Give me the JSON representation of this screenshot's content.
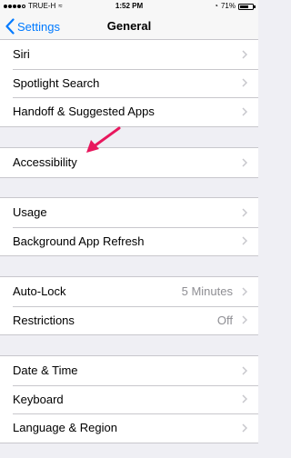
{
  "status_bar": {
    "carrier": "TRUE-H",
    "time": "1:52 PM",
    "battery": "71%",
    "battery_level": 0.71
  },
  "nav": {
    "back_label": "Settings",
    "title": "General"
  },
  "groups": [
    [
      {
        "label": "Siri"
      },
      {
        "label": "Spotlight Search"
      },
      {
        "label": "Handoff & Suggested Apps"
      }
    ],
    [
      {
        "label": "Accessibility"
      }
    ],
    [
      {
        "label": "Usage"
      },
      {
        "label": "Background App Refresh"
      }
    ],
    [
      {
        "label": "Auto-Lock",
        "value": "5 Minutes"
      },
      {
        "label": "Restrictions",
        "value": "Off"
      }
    ],
    [
      {
        "label": "Date & Time"
      },
      {
        "label": "Keyboard"
      },
      {
        "label": "Language & Region"
      }
    ]
  ],
  "colors": {
    "accent": "#007aff",
    "annotation_arrow": "#e8175d",
    "background": "#efeff4"
  },
  "icons": {
    "back": "chevron-left-icon",
    "disclosure": "chevron-right-icon",
    "annotation": "arrow-icon"
  }
}
